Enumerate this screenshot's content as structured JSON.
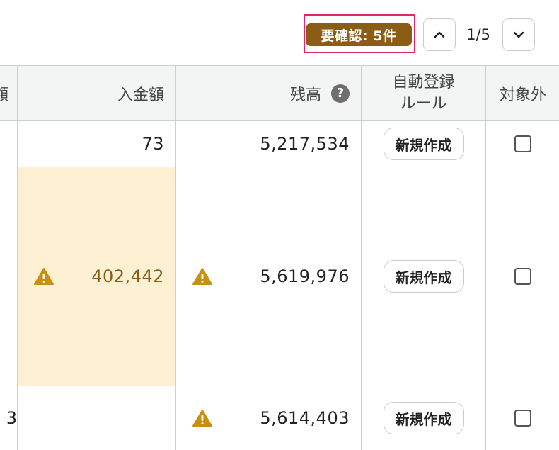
{
  "toolbar": {
    "review_badge": "要確認: 5件",
    "pager": "1/5",
    "prev_icon": "chevron-up-icon",
    "next_icon": "chevron-down-icon"
  },
  "table": {
    "headers": {
      "clipped": "額",
      "deposit": "入金額",
      "balance": "残高",
      "balance_help": "?",
      "auto_rule_line1": "自動登録",
      "auto_rule_line2": "ルール",
      "excluded": "対象外"
    },
    "rows": [
      {
        "clipped": "",
        "deposit": "73",
        "balance": "5,217,534",
        "create_button": "新規作成",
        "deposit_warning": false,
        "balance_warning": false
      },
      {
        "clipped": "",
        "deposit": "402,442",
        "balance": "5,619,976",
        "create_button": "新規作成",
        "deposit_warning": true,
        "balance_warning": true
      },
      {
        "clipped": "3",
        "deposit": "",
        "balance": "5,614,403",
        "create_button": "新規作成",
        "deposit_warning": false,
        "balance_warning": true
      }
    ]
  },
  "colors": {
    "badge_bg": "#8a5c14",
    "highlight_border": "#e0246e",
    "warning_bg": "#fdf0d3",
    "warning_icon": "#c8900f"
  }
}
